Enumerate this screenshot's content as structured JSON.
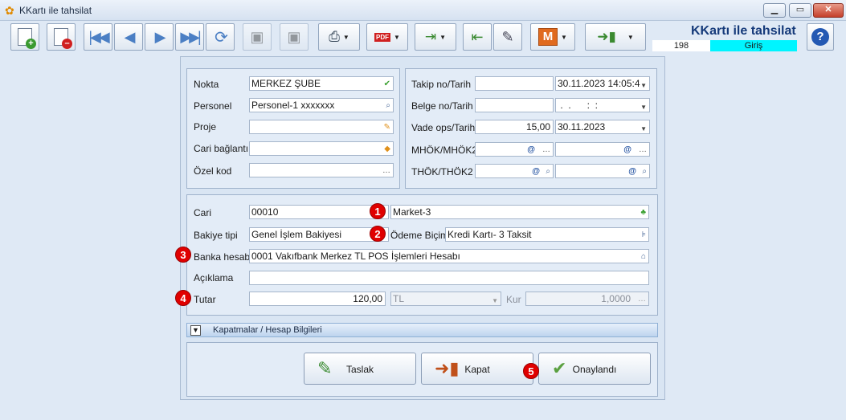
{
  "window": {
    "title": "KKartı ile tahsilat",
    "minimize": "▁",
    "maximize": "▭",
    "close": "✕"
  },
  "header": {
    "title": "KKartı ile tahsilat",
    "number": "198",
    "status": "Giriş",
    "help": "?"
  },
  "toolbar": {
    "pdf_label": "PDF",
    "m_label": "M"
  },
  "left_panel": {
    "nokta": {
      "label": "Nokta",
      "value": "MERKEZ ŞUBE"
    },
    "personel": {
      "label": "Personel",
      "value": "Personel-1 xxxxxxx"
    },
    "proje": {
      "label": "Proje",
      "value": ""
    },
    "cari_baglanti": {
      "label": "Cari bağlantı",
      "value": ""
    },
    "ozel_kod": {
      "label": "Özel kod",
      "value": ""
    }
  },
  "right_panel": {
    "takip": {
      "label": "Takip no/Tarih",
      "number": "",
      "date": "30.11.2023 14:05:4"
    },
    "belge": {
      "label": "Belge no/Tarih",
      "number": "",
      "date": " .  .      :  :"
    },
    "vade": {
      "label": "Vade ops/Tarih",
      "number": "15,00",
      "date": "30.11.2023"
    },
    "mhok": {
      "label": "MHÖK/MHÖK2"
    },
    "thok": {
      "label": "THÖK/THÖK2"
    }
  },
  "details": {
    "cari": {
      "label": "Cari",
      "code": "00010",
      "name": "Market-3"
    },
    "bakiye": {
      "label": "Bakiye tipi",
      "value": "Genel İşlem Bakiyesi"
    },
    "odeme": {
      "label": "Ödeme Biçimi",
      "value": "Kredi Kartı- 3 Taksit"
    },
    "banka": {
      "label": "Banka hesabı",
      "value": "0001 Vakıfbank Merkez TL POS İşlemleri Hesabı"
    },
    "aciklama": {
      "label": "Açıklama",
      "value": ""
    },
    "tutar": {
      "label": "Tutar",
      "value": "120,00",
      "currency": "TL",
      "kur_label": "Kur",
      "kur_value": "1,0000"
    }
  },
  "markers": [
    "1",
    "2",
    "3",
    "4",
    "5"
  ],
  "collapse": {
    "label": "Kapatmalar / Hesap Bilgileri"
  },
  "actions": {
    "taslak": "Taslak",
    "kapat": "Kapat",
    "onaylandi": "Onaylandı"
  }
}
